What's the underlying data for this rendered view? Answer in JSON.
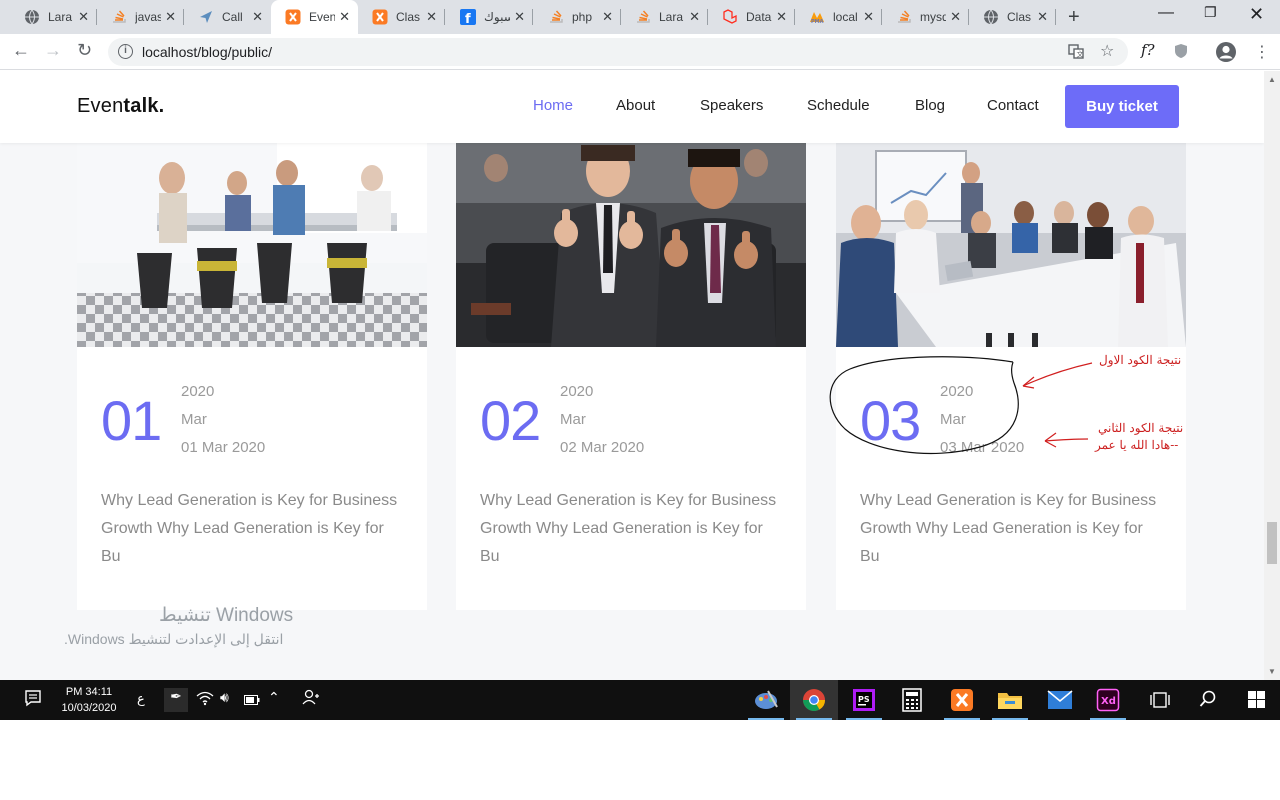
{
  "browser": {
    "tabs": [
      {
        "title": "Lara",
        "fav": "globe"
      },
      {
        "title": "javas",
        "fav": "stack"
      },
      {
        "title": "Call",
        "fav": "arrow"
      },
      {
        "title": "Even",
        "fav": "xampp",
        "active": true
      },
      {
        "title": "Clas",
        "fav": "xampp"
      },
      {
        "title": "فيسبوك",
        "fav": "facebook"
      },
      {
        "title": "php",
        "fav": "stack"
      },
      {
        "title": "Lara",
        "fav": "stack"
      },
      {
        "title": "Data",
        "fav": "laravel"
      },
      {
        "title": "local",
        "fav": "pma"
      },
      {
        "title": "mysq",
        "fav": "stack"
      },
      {
        "title": "Clas",
        "fav": "globe"
      }
    ],
    "url": "localhost/blog/public/"
  },
  "site": {
    "logo_regular": "Even",
    "logo_bold": "talk.",
    "nav": [
      "Home",
      "About",
      "Speakers",
      "Schedule",
      "Blog",
      "Contact"
    ],
    "nav_active": "Home",
    "buy_label": "Buy ticket"
  },
  "posts": [
    {
      "number": "01",
      "year": "2020",
      "month": "Mar",
      "date": "01 Mar 2020",
      "text": "Why Lead Generation is Key for Business Growth Why Lead Generation is Key for Bu"
    },
    {
      "number": "02",
      "year": "2020",
      "month": "Mar",
      "date": "02 Mar 2020",
      "text": "Why Lead Generation is Key for Business Growth Why Lead Generation is Key for Bu"
    },
    {
      "number": "03",
      "year": "2020",
      "month": "Mar",
      "date": "03 Mar 2020",
      "text": "Why Lead Generation is Key for Business Growth Why Lead Generation is Key for Bu"
    }
  ],
  "annotations": {
    "first": "نتيجة الكود الاول",
    "second_line1": "نتيجة الكود الثاني",
    "second_line2": "--هادا الله يا عمر"
  },
  "watermark": {
    "line1": "تنشيط Windows",
    "line2": "انتقل إلى الإعدادت لتنشيط Windows."
  },
  "taskbar": {
    "time": "PM 34:11",
    "date": "10/03/2020",
    "lang": "ع"
  },
  "colors": {
    "accent": "#6c6cf2",
    "button": "#6d6cf8",
    "annotation": "#cc1f1f"
  }
}
